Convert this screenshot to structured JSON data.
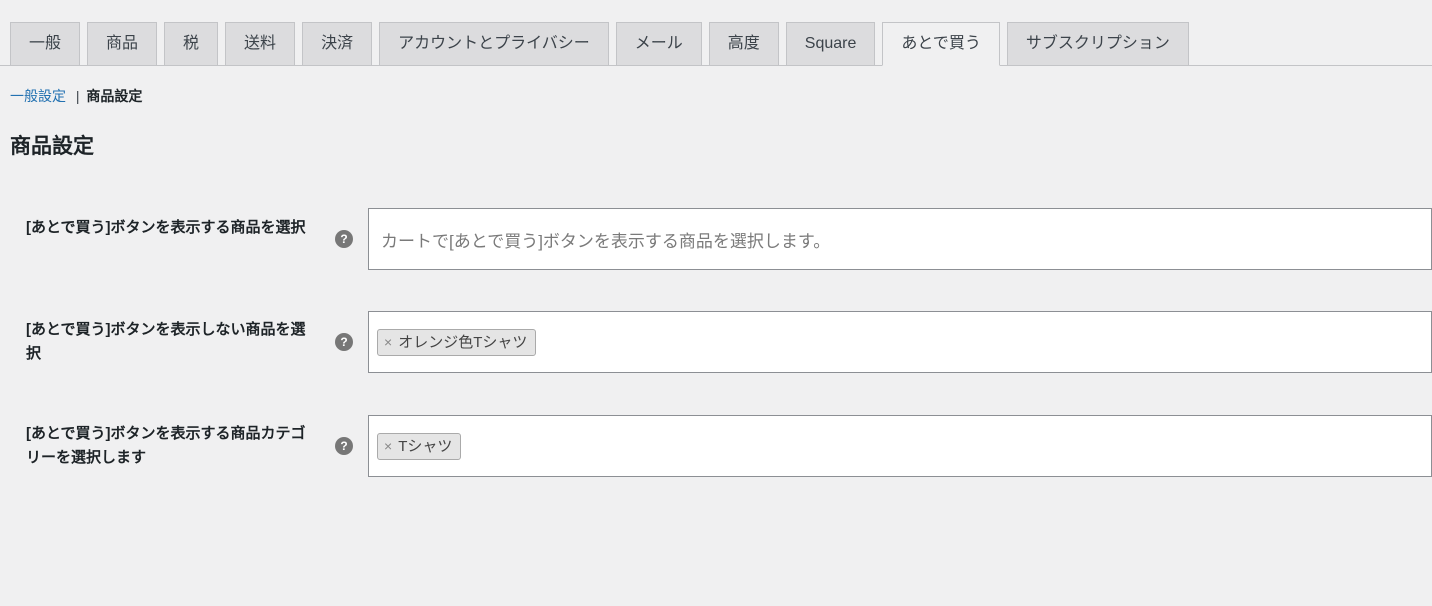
{
  "tabs": {
    "items": [
      {
        "label": "一般",
        "active": false
      },
      {
        "label": "商品",
        "active": false
      },
      {
        "label": "税",
        "active": false
      },
      {
        "label": "送料",
        "active": false
      },
      {
        "label": "決済",
        "active": false
      },
      {
        "label": "アカウントとプライバシー",
        "active": false
      },
      {
        "label": "メール",
        "active": false
      },
      {
        "label": "高度",
        "active": false
      },
      {
        "label": "Square",
        "active": false
      },
      {
        "label": "あとで買う",
        "active": true
      },
      {
        "label": "サブスクリプション",
        "active": false
      }
    ]
  },
  "subnav": {
    "link_label": "一般設定",
    "current_label": "商品設定"
  },
  "section_title": "商品設定",
  "fields": {
    "show_products": {
      "label": "[あとで買う]ボタンを表示する商品を選択",
      "placeholder": "カートで[あとで買う]ボタンを表示する商品を選択します。",
      "chips": []
    },
    "hide_products": {
      "label": "[あとで買う]ボタンを表示しない商品を選択",
      "placeholder": "",
      "chips": [
        "オレンジ色Tシャツ"
      ]
    },
    "show_categories": {
      "label": "[あとで買う]ボタンを表示する商品カテゴリーを選択します",
      "placeholder": "",
      "chips": [
        "Tシャツ"
      ]
    }
  },
  "help_glyph": "?"
}
